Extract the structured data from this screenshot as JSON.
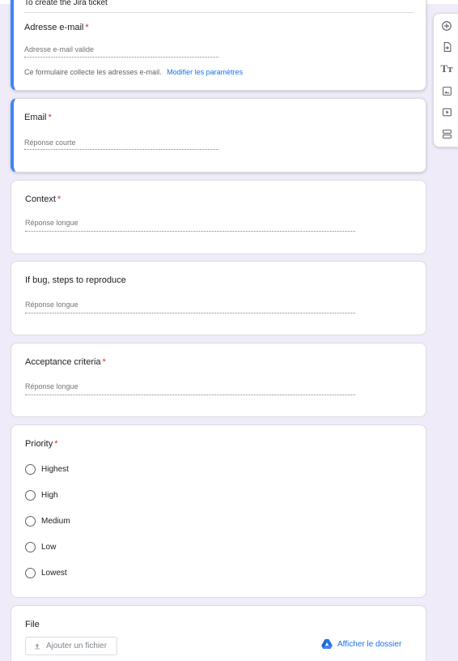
{
  "header": {
    "description_partial": "To create the Jira ticket"
  },
  "email_collection": {
    "title": "Adresse e-mail",
    "required_mark": "*",
    "placeholder": "Adresse e-mail valide",
    "notice": "Ce formulaire collecte les adresses e-mail.",
    "settings_link": "Modifier les paramètres"
  },
  "questions": [
    {
      "title": "Email",
      "required_mark": "*",
      "hint": "Réponse courte",
      "type": "short"
    },
    {
      "title": "Context",
      "required_mark": "*",
      "hint": "Réponse longue",
      "type": "long"
    },
    {
      "title": "If bug, steps to reproduce",
      "required_mark": "",
      "hint": "Réponse longue",
      "type": "long"
    },
    {
      "title": "Acceptance criteria",
      "required_mark": "*",
      "hint": "Réponse longue",
      "type": "long"
    }
  ],
  "priority": {
    "title": "Priority",
    "required_mark": "*",
    "options": [
      "Highest",
      "High",
      "Medium",
      "Low",
      "Lowest"
    ]
  },
  "file": {
    "title": "File",
    "add_button": "Ajouter un fichier",
    "folder_link": "Afficher le dossier"
  },
  "toolbar": {
    "icons": [
      "add-question-icon",
      "import-questions-icon",
      "add-title-icon",
      "add-image-icon",
      "add-video-icon",
      "add-section-icon"
    ]
  },
  "colors": {
    "accent": "#673ab7",
    "active_border": "#4285f4",
    "required": "#d93025",
    "link": "#1a73e8",
    "background": "#efebf8"
  }
}
